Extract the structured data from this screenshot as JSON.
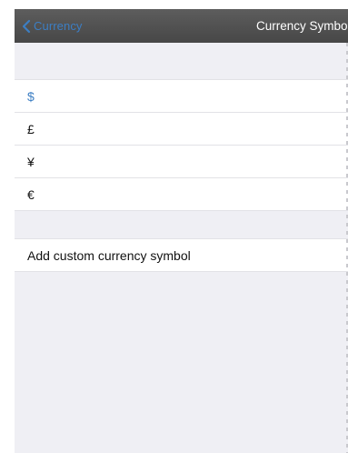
{
  "navbar": {
    "back_label": "Currency",
    "title": "Currency Symbo"
  },
  "symbols": {
    "items": [
      {
        "label": "$",
        "selected": true
      },
      {
        "label": "£",
        "selected": false
      },
      {
        "label": "¥",
        "selected": false
      },
      {
        "label": "€",
        "selected": false
      }
    ]
  },
  "custom": {
    "label": "Add custom currency symbol"
  },
  "colors": {
    "accent": "#3c7ec3",
    "navbar": "#4f4f4f",
    "grouped_background": "#efeff4"
  }
}
